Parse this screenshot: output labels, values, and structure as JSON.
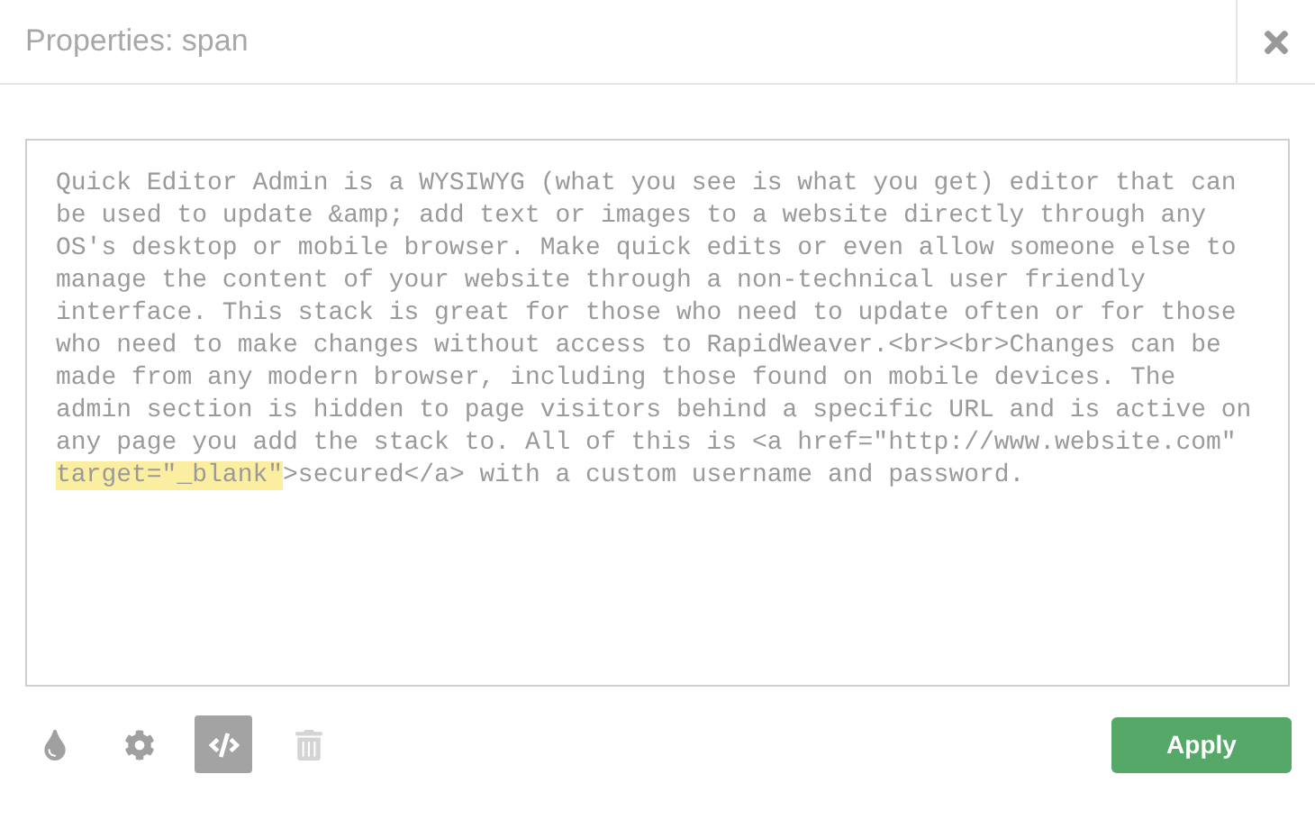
{
  "window": {
    "title": "Properties: span"
  },
  "editor": {
    "text_before": "Quick Editor Admin is a WYSIWYG (what you see is what you get) editor that can be used to update &amp; add text or images to a website directly through any OS's desktop or mobile browser. Make quick edits or even allow someone else to manage the content of your website through a non-technical user friendly interface. This stack is great for those who need to update often or for those who need to make changes without access to RapidWeaver.<br><br>Changes can be made from any modern browser, including those found on mobile devices. The admin section is hidden to page visitors behind a specific URL and is active on any page you add the stack to. All of this is <a href=\"http://www.website.com\" ",
    "selection": "target=\"_blank\"",
    "text_after": ">secured</a> with a custom username and password."
  },
  "toolbar": [
    {
      "kind": "color",
      "selected": false,
      "disabled": false
    },
    {
      "kind": "settings",
      "selected": false,
      "disabled": false
    },
    {
      "kind": "code",
      "selected": true,
      "disabled": false
    },
    {
      "kind": "delete",
      "selected": false,
      "disabled": true
    }
  ],
  "apply_button": "Apply"
}
